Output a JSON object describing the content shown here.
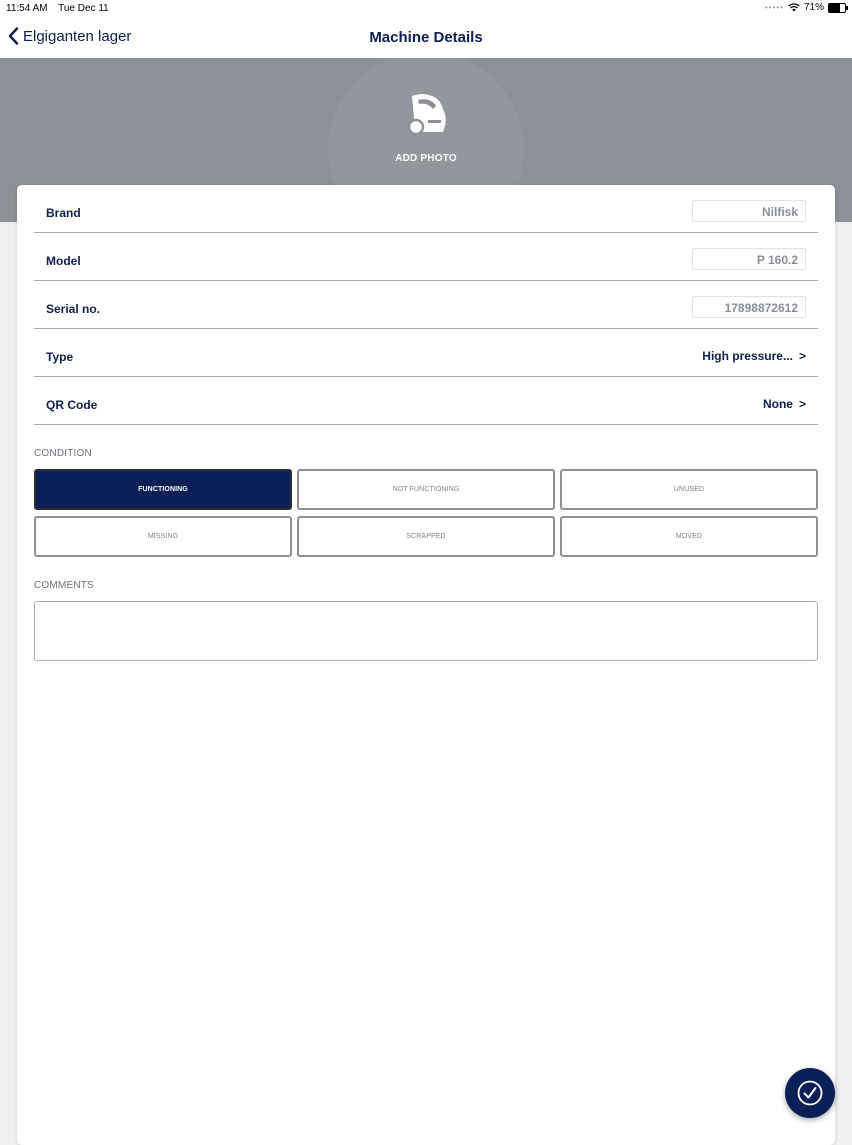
{
  "status_bar": {
    "time": "11:54 AM",
    "date": "Tue Dec 11",
    "battery": "71%",
    "battery_level": 0.71
  },
  "nav": {
    "back_label": "Elgiganten lager",
    "title": "Machine Details"
  },
  "photo": {
    "add_label": "ADD PHOTO",
    "icon": "machine-icon"
  },
  "fields": {
    "brand": {
      "label": "Brand",
      "value": "Nilfisk"
    },
    "model": {
      "label": "Model",
      "value": "P 160.2"
    },
    "serial": {
      "label": "Serial no.",
      "value": "17898872612"
    },
    "type": {
      "label": "Type",
      "value": "High pressure..."
    },
    "qr": {
      "label": "QR Code",
      "value": "None"
    }
  },
  "condition": {
    "section_label": "CONDITION",
    "options": [
      "FUNCTIONING",
      "NOT FUNCTIONING",
      "UNUSED",
      "MISSING",
      "SCRAPPED",
      "MOVED"
    ],
    "selected": "FUNCTIONING"
  },
  "comments": {
    "section_label": "COMMENTS",
    "value": ""
  },
  "colors": {
    "brand_navy": "#0b1f57",
    "header_gray": "#8b9196"
  },
  "icons": {
    "back": "chevron-left-icon",
    "save": "checkmark-circle-icon"
  }
}
